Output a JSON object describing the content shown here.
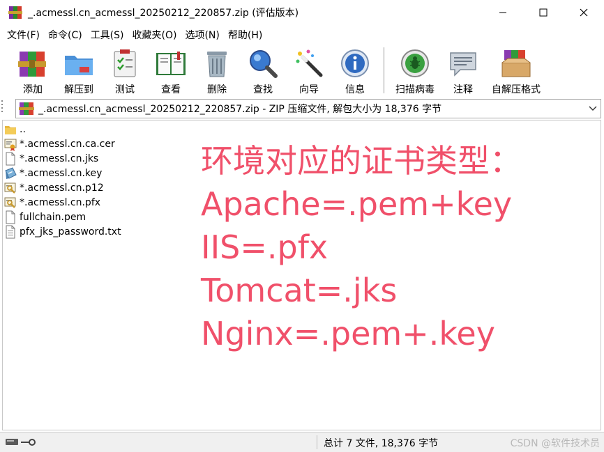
{
  "window": {
    "title": "_.acmessl.cn_acmessl_20250212_220857.zip (评估版本)",
    "icons": [
      "winrar-app-icon",
      "minimize-icon",
      "maximize-icon",
      "close-icon"
    ]
  },
  "menu": {
    "items": [
      "文件(F)",
      "命令(C)",
      "工具(S)",
      "收藏夹(O)",
      "选项(N)",
      "帮助(H)"
    ]
  },
  "toolbar": {
    "buttons": [
      {
        "label": "添加",
        "icon": "add-archive-icon"
      },
      {
        "label": "解压到",
        "icon": "extract-to-icon"
      },
      {
        "label": "测试",
        "icon": "test-icon"
      },
      {
        "label": "查看",
        "icon": "view-book-icon"
      },
      {
        "label": "删除",
        "icon": "delete-trash-icon"
      },
      {
        "label": "查找",
        "icon": "find-magnifier-icon"
      },
      {
        "label": "向导",
        "icon": "wizard-wand-icon"
      },
      {
        "label": "信息",
        "icon": "info-icon"
      },
      {
        "label": "扫描病毒",
        "icon": "virus-scan-icon"
      },
      {
        "label": "注释",
        "icon": "comment-icon"
      },
      {
        "label": "自解压格式",
        "icon": "sfx-icon"
      }
    ]
  },
  "address": {
    "text": "_.acmessl.cn_acmessl_20250212_220857.zip - ZIP 压缩文件, 解包大小为 18,376 字节"
  },
  "files": [
    {
      "name": "..",
      "icon": "folder-up-icon"
    },
    {
      "name": "*.acmessl.cn.ca.cer",
      "icon": "certificate-icon"
    },
    {
      "name": "*.acmessl.cn.jks",
      "icon": "blank-file-icon"
    },
    {
      "name": "*.acmessl.cn.key",
      "icon": "key-file-icon"
    },
    {
      "name": "*.acmessl.cn.p12",
      "icon": "pfx-file-icon"
    },
    {
      "name": "*.acmessl.cn.pfx",
      "icon": "pfx-file-icon"
    },
    {
      "name": "fullchain.pem",
      "icon": "blank-file-icon"
    },
    {
      "name": "pfx_jks_password.txt",
      "icon": "text-file-icon"
    }
  ],
  "overlay": {
    "lines": [
      "环境对应的证书类型：",
      "Apache=.pem+key",
      "IIS=.pfx",
      "Tomcat=.jks",
      "Nginx=.pem+.key"
    ],
    "color": "#f0506a"
  },
  "status": {
    "summary": "总计 7 文件, 18,376 字节",
    "watermark": "CSDN @软件技术员"
  }
}
